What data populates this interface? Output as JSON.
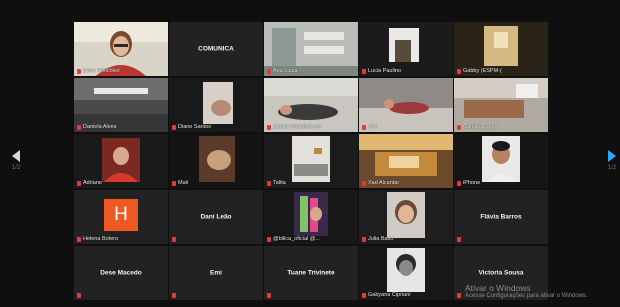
{
  "tiles": [
    {
      "name": "Ester Welchkel",
      "label": "",
      "active": true
    },
    {
      "name": "",
      "label": "COMUNICA",
      "active": false
    },
    {
      "name": "Ana Luiza",
      "label": "",
      "active": false
    },
    {
      "name": "Lucia Paulino",
      "label": "",
      "active": false
    },
    {
      "name": "Gabby (ESPM-(",
      "label": "",
      "active": false
    },
    {
      "name": "Daniela Alves",
      "label": "",
      "active": false
    },
    {
      "name": "Diane Santos",
      "label": "",
      "active": false
    },
    {
      "name": "Estela Ramalho-rox",
      "label": "",
      "active": false
    },
    {
      "name": "Yna",
      "label": "",
      "active": false
    },
    {
      "name": "Camila Cunha",
      "label": "",
      "active": false
    },
    {
      "name": "Adriane",
      "label": "",
      "active": false
    },
    {
      "name": "Mali",
      "label": "",
      "active": false
    },
    {
      "name": "Talita",
      "label": "",
      "active": false
    },
    {
      "name": "Xad Alcantar",
      "label": "",
      "active": false
    },
    {
      "name": "iPhone",
      "label": "",
      "active": false
    },
    {
      "name": "Helena Botero",
      "label": "",
      "active": false
    },
    {
      "name": "",
      "label": "Dani Leão",
      "active": false
    },
    {
      "name": "@bilica_oficial @...",
      "label": "",
      "active": false
    },
    {
      "name": "Julia Baso",
      "label": "",
      "active": false
    },
    {
      "name": "",
      "label": "Flávia Barros",
      "active": false
    },
    {
      "name": "",
      "label": "Dese Macedo",
      "active": false
    },
    {
      "name": "",
      "label": "Emi",
      "active": false
    },
    {
      "name": "",
      "label": "Tuane Trivinete",
      "active": false
    },
    {
      "name": "Gabyana Cipriani",
      "label": "",
      "active": false
    },
    {
      "name": "",
      "label": "Victoria Sousa",
      "active": false
    }
  ],
  "avatar_letter": "H",
  "nav": {
    "page_left": "1/2",
    "page_right": "1/2"
  },
  "watermark": {
    "line1": "Ativar o Windows",
    "line2": "Acesse Configurações para ativar o Windows."
  },
  "colors": {
    "active_border": "#c9d64a",
    "next_arrow": "#2aa8ff",
    "muted_mic": "#e23b3b",
    "avatar_bg": "#f05a22"
  },
  "icons": {
    "prev": "arrow-left-icon",
    "next": "arrow-right-icon",
    "mic": "mic-muted-icon"
  }
}
